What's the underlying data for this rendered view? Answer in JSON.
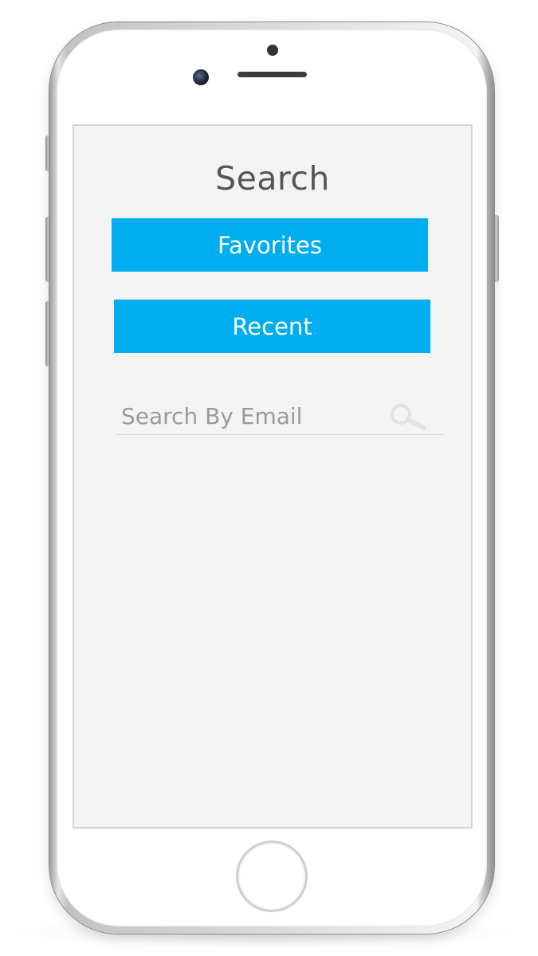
{
  "screen": {
    "title": "Search",
    "buttons": {
      "favorites_label": "Favorites",
      "recent_label": "Recent"
    },
    "search": {
      "placeholder": "Search By Email",
      "value": "",
      "icon": "magnifier-icon"
    }
  },
  "colors": {
    "accent": "#00adef",
    "screen_background": "#f3f3f3",
    "title_text": "#555555",
    "button_text": "#ffffff"
  }
}
